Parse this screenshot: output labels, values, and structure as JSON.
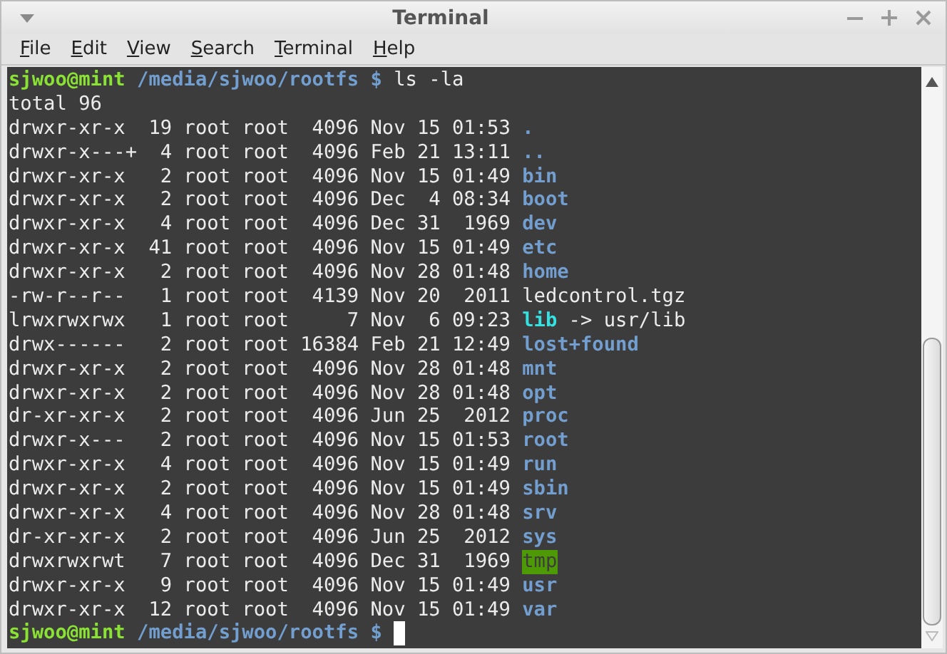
{
  "window": {
    "title": "Terminal"
  },
  "menu": [
    "File",
    "Edit",
    "View",
    "Search",
    "Terminal",
    "Help"
  ],
  "terminal": {
    "lines": [
      {
        "kind": "prompt",
        "user": "sjwoo@mint",
        "path": "/media/sjwoo/rootfs $",
        "command": "ls -la",
        "cursor": false
      },
      {
        "kind": "text",
        "text": "total 96"
      },
      {
        "kind": "dir",
        "info": "drwxr-xr-x  19 root root  4096 Nov 15 01:53",
        "name": "."
      },
      {
        "kind": "dir",
        "info": "drwxr-x---+  4 root root  4096 Feb 21 13:11",
        "name": ".."
      },
      {
        "kind": "dir",
        "info": "drwxr-xr-x   2 root root  4096 Nov 15 01:49",
        "name": "bin"
      },
      {
        "kind": "dir",
        "info": "drwxr-xr-x   2 root root  4096 Dec  4 08:34",
        "name": "boot"
      },
      {
        "kind": "dir",
        "info": "drwxr-xr-x   4 root root  4096 Dec 31  1969",
        "name": "dev"
      },
      {
        "kind": "dir",
        "info": "drwxr-xr-x  41 root root  4096 Nov 15 01:49",
        "name": "etc"
      },
      {
        "kind": "dir",
        "info": "drwxr-xr-x   2 root root  4096 Nov 28 01:48",
        "name": "home"
      },
      {
        "kind": "file",
        "info": "-rw-r--r--   1 root root  4139 Nov 20  2011",
        "name": "ledcontrol.tgz"
      },
      {
        "kind": "link",
        "info": "lrwxrwxrwx   1 root root     7 Nov  6 09:23",
        "name": "lib",
        "target": "-> usr/lib"
      },
      {
        "kind": "dir",
        "info": "drwx------   2 root root 16384 Feb 21 12:49",
        "name": "lost+found"
      },
      {
        "kind": "dir",
        "info": "drwxr-xr-x   2 root root  4096 Nov 28 01:48",
        "name": "mnt"
      },
      {
        "kind": "dir",
        "info": "drwxr-xr-x   2 root root  4096 Nov 28 01:48",
        "name": "opt"
      },
      {
        "kind": "dir",
        "info": "dr-xr-xr-x   2 root root  4096 Jun 25  2012",
        "name": "proc"
      },
      {
        "kind": "dir",
        "info": "drwxr-x---   2 root root  4096 Nov 15 01:53",
        "name": "root"
      },
      {
        "kind": "dir",
        "info": "drwxr-xr-x   4 root root  4096 Nov 15 01:49",
        "name": "run"
      },
      {
        "kind": "dir",
        "info": "drwxr-xr-x   2 root root  4096 Nov 15 01:49",
        "name": "sbin"
      },
      {
        "kind": "dir",
        "info": "drwxr-xr-x   4 root root  4096 Nov 28 01:48",
        "name": "srv"
      },
      {
        "kind": "dir",
        "info": "dr-xr-xr-x   2 root root  4096 Jun 25  2012",
        "name": "sys"
      },
      {
        "kind": "sticky",
        "info": "drwxrwxrwt   7 root root  4096 Dec 31  1969",
        "name": "tmp"
      },
      {
        "kind": "dir",
        "info": "drwxr-xr-x   9 root root  4096 Nov 15 01:49",
        "name": "usr"
      },
      {
        "kind": "dir",
        "info": "drwxr-xr-x  12 root root  4096 Nov 15 01:49",
        "name": "var"
      },
      {
        "kind": "prompt",
        "user": "sjwoo@mint",
        "path": "/media/sjwoo/rootfs $",
        "cursor": true
      }
    ]
  }
}
